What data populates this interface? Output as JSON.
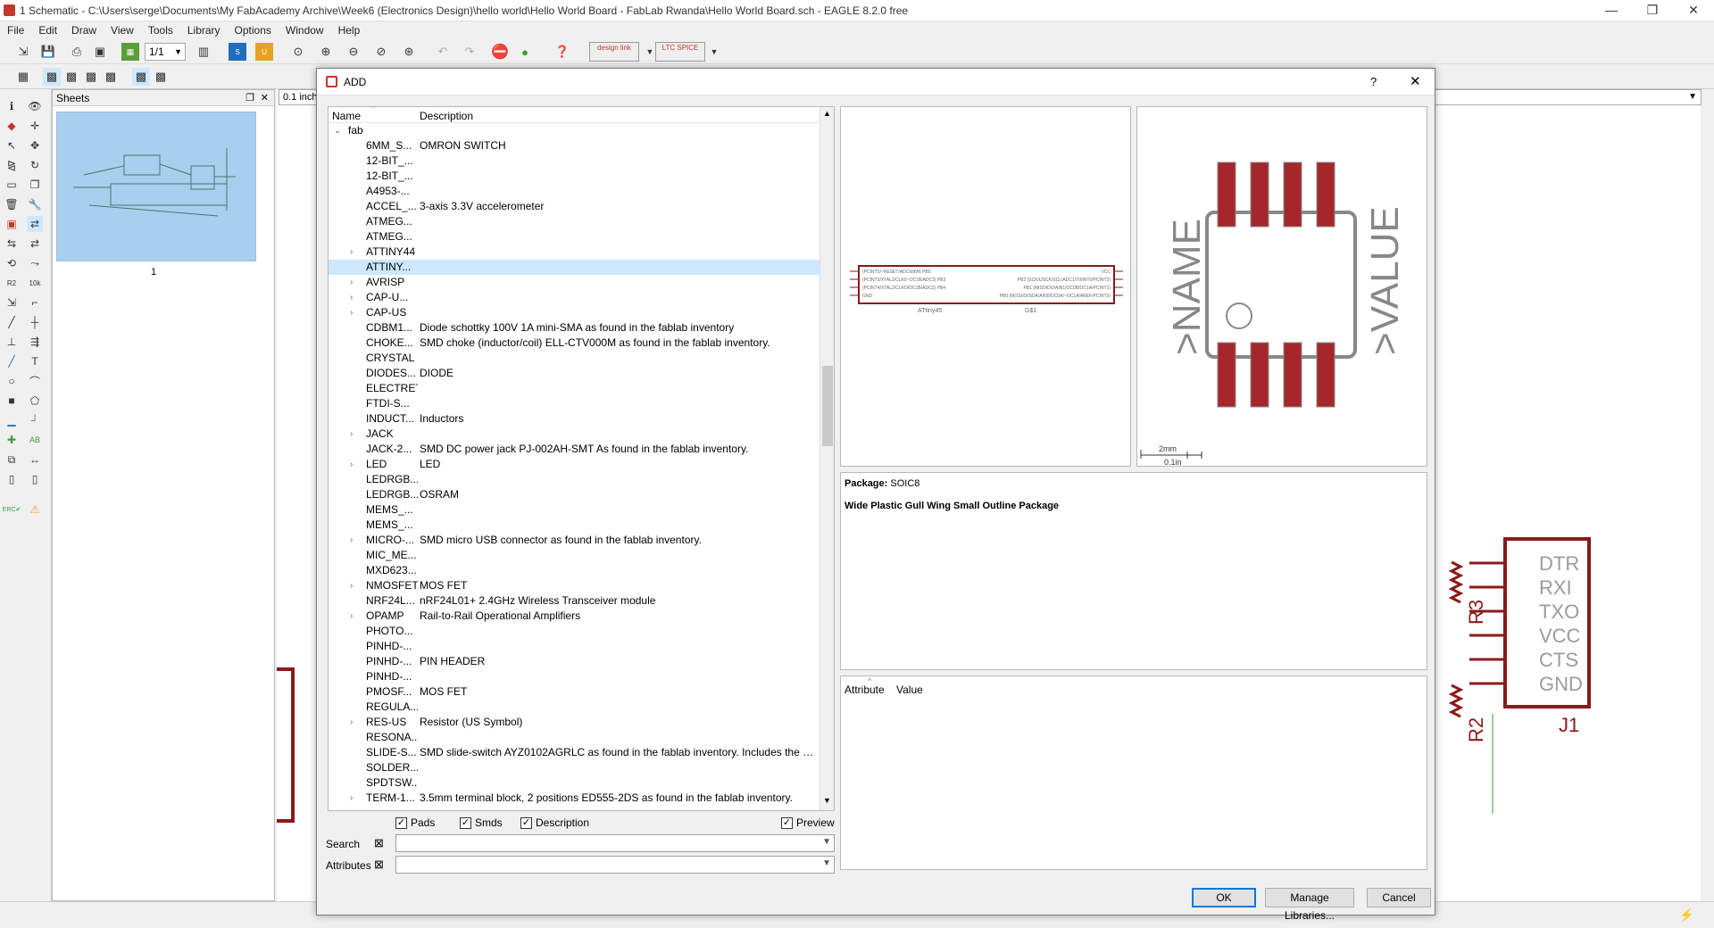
{
  "window": {
    "title": "1 Schematic - C:\\Users\\serge\\Documents\\My FabAcademy Archive\\Week6 (Electronics Design)\\hello world\\Hello World Board - FabLab Rwanda\\Hello World Board.sch - EAGLE 8.2.0 free"
  },
  "menu": [
    "File",
    "Edit",
    "Draw",
    "View",
    "Tools",
    "Library",
    "Options",
    "Window",
    "Help"
  ],
  "toolbar": {
    "sheet_select": "1/1",
    "design_link": "design link",
    "ltc_spice": "LTC SPICE"
  },
  "grid": {
    "value": "0.1 inch"
  },
  "sheets": {
    "title": "Sheets",
    "page_label": "1"
  },
  "dialog": {
    "title": "ADD",
    "help": "?",
    "close": "✕",
    "columns": {
      "name": "Name",
      "description": "Description"
    },
    "root": "fab",
    "rows": [
      {
        "name": "6MM_S...",
        "desc": "OMRON SWITCH",
        "exp": false
      },
      {
        "name": "12-BIT_...",
        "desc": "",
        "exp": false
      },
      {
        "name": "12-BIT_...",
        "desc": "",
        "exp": false
      },
      {
        "name": "A4953-...",
        "desc": "",
        "exp": false
      },
      {
        "name": "ACCEL_...",
        "desc": "3-axis 3.3V accelerometer",
        "exp": false
      },
      {
        "name": "ATMEG...",
        "desc": "",
        "exp": false
      },
      {
        "name": "ATMEG...",
        "desc": "",
        "exp": false
      },
      {
        "name": "ATTINY44",
        "desc": "",
        "exp": true
      },
      {
        "name": "ATTINY...",
        "desc": "",
        "exp": false,
        "sel": true
      },
      {
        "name": "AVRISP",
        "desc": "",
        "exp": true
      },
      {
        "name": "CAP-U...",
        "desc": "",
        "exp": true
      },
      {
        "name": "CAP-US",
        "desc": "",
        "exp": true
      },
      {
        "name": "CDBM1...",
        "desc": "Diode schottky 100V 1A mini-SMA as found in the fablab inventory",
        "exp": false
      },
      {
        "name": "CHOKE...",
        "desc": "SMD choke (inductor/coil) ELL-CTV000M as found in the fablab inventory.",
        "exp": false
      },
      {
        "name": "CRYSTAL",
        "desc": "",
        "exp": false
      },
      {
        "name": "DIODES...",
        "desc": "DIODE",
        "exp": false
      },
      {
        "name": "ELECTRET",
        "desc": "",
        "exp": false
      },
      {
        "name": "FTDI-S...",
        "desc": "",
        "exp": false
      },
      {
        "name": "INDUCT...",
        "desc": "Inductors",
        "exp": false
      },
      {
        "name": "JACK",
        "desc": "",
        "exp": true
      },
      {
        "name": "JACK-2...",
        "desc": "SMD DC power jack PJ-002AH-SMT As found in the fablab inventory.",
        "exp": false
      },
      {
        "name": "LED",
        "desc": "LED",
        "exp": true
      },
      {
        "name": "LEDRGB...",
        "desc": "",
        "exp": false
      },
      {
        "name": "LEDRGB...",
        "desc": "OSRAM",
        "exp": false
      },
      {
        "name": "MEMS_...",
        "desc": "",
        "exp": false
      },
      {
        "name": "MEMS_...",
        "desc": "",
        "exp": false
      },
      {
        "name": "MICRO-...",
        "desc": "SMD micro USB connector as found in the fablab inventory.",
        "exp": true
      },
      {
        "name": "MIC_ME...",
        "desc": "",
        "exp": false
      },
      {
        "name": "MXD623...",
        "desc": "",
        "exp": false
      },
      {
        "name": "NMOSFET",
        "desc": "MOS FET",
        "exp": true
      },
      {
        "name": "NRF24L...",
        "desc": "nRF24L01+ 2.4GHz Wireless Transceiver module",
        "exp": false
      },
      {
        "name": "OPAMP",
        "desc": "Rail-to-Rail Operational Amplifiers",
        "exp": true
      },
      {
        "name": "PHOTO...",
        "desc": "",
        "exp": false
      },
      {
        "name": "PINHD-...",
        "desc": "",
        "exp": false
      },
      {
        "name": "PINHD-...",
        "desc": "PIN HEADER",
        "exp": false
      },
      {
        "name": "PINHD-...",
        "desc": "",
        "exp": false
      },
      {
        "name": "PMOSF...",
        "desc": "MOS FET",
        "exp": false
      },
      {
        "name": "REGULA...",
        "desc": "",
        "exp": false
      },
      {
        "name": "RES-US",
        "desc": "Resistor (US Symbol)",
        "exp": true
      },
      {
        "name": "RESONA...",
        "desc": "",
        "exp": false
      },
      {
        "name": "SLIDE-S...",
        "desc": "SMD slide-switch AYZ0102AGRLC as found in the fablab inventory.  Includes the m...",
        "exp": false
      },
      {
        "name": "SOLDER...",
        "desc": "",
        "exp": false
      },
      {
        "name": "SPDTSW...",
        "desc": "",
        "exp": false
      },
      {
        "name": "TERM-1...",
        "desc": "3.5mm terminal block, 2 positions ED555-2DS as found in the fablab inventory.",
        "exp": true
      }
    ],
    "checkboxes": {
      "pads": "Pads",
      "smds": "Smds",
      "description": "Description",
      "preview": "Preview"
    },
    "search_label": "Search",
    "attributes_label": "Attributes",
    "search_value": "",
    "attributes_value": "",
    "symbol_preview": {
      "part_name": "ATtiny45",
      "gate_name": "G$1",
      "left_pins": [
        "(PCINT5/~RESET/ADC0/dW) PB5",
        "(PCINT3/XTAL1/CLKI/~OC1B/ADC3) PB3",
        "(PCINT4/XTAL2/CLKO/OC1B/ADC2) PB4",
        "GND"
      ],
      "right_pins": [
        "VCC",
        "PB2 (SCK/USCK/SCL/ADC1/T0/INT0/PCINT2)",
        "PB1 (MISO/DO/AIN1/OC0B/OC1A/PCINT1)",
        "PB0 (MOSI/DI/SDA/AIN0/OC0A/~OC1A/AREF/PCINT0)"
      ]
    },
    "package_preview": {
      "name_text": ">NAME",
      "value_text": ">VALUE",
      "scale_mm": "2mm",
      "scale_in": "0.1in"
    },
    "package_label": "Package:",
    "package_name": "SOIC8",
    "package_desc": "Wide Plastic Gull Wing Small Outline Package",
    "attr_cols": {
      "attribute": "Attribute",
      "value": "Value"
    },
    "buttons": {
      "ok": "OK",
      "manage": "Manage Libraries...",
      "cancel": "Cancel"
    }
  },
  "schematic": {
    "connector_name": "J1",
    "pins": [
      "DTR",
      "RXI",
      "TXO",
      "VCC",
      "CTS",
      "GND"
    ],
    "r3": "R3",
    "r2": "R2"
  },
  "colors": {
    "pcb_red": "#8b1a1a",
    "pad_red": "#a5272b",
    "sel_blue": "#cde8ff",
    "thumb_blue": "#a9cfee"
  }
}
